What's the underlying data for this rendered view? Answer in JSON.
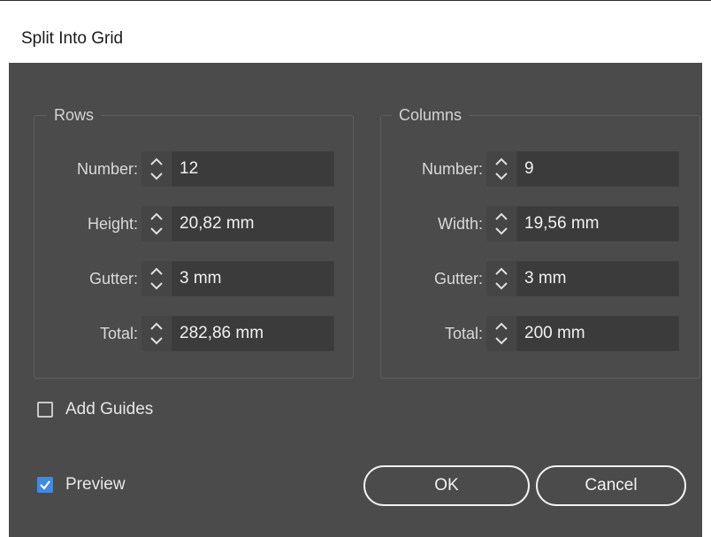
{
  "window": {
    "title": "Split Into Grid"
  },
  "rows_group": {
    "title": "Rows",
    "number": {
      "label": "Number:",
      "value": "12"
    },
    "height": {
      "label": "Height:",
      "value": "20,82 mm"
    },
    "gutter": {
      "label": "Gutter:",
      "value": "3 mm"
    },
    "total": {
      "label": "Total:",
      "value": "282,86 mm"
    }
  },
  "columns_group": {
    "title": "Columns",
    "number": {
      "label": "Number:",
      "value": "9"
    },
    "width": {
      "label": "Width:",
      "value": "19,56 mm"
    },
    "gutter": {
      "label": "Gutter:",
      "value": "3 mm"
    },
    "total": {
      "label": "Total:",
      "value": "200 mm"
    }
  },
  "options": {
    "add_guides": {
      "label": "Add Guides",
      "checked": false
    },
    "preview": {
      "label": "Preview",
      "checked": true
    }
  },
  "buttons": {
    "ok": "OK",
    "cancel": "Cancel"
  },
  "colors": {
    "dialog_bg": "#4b4b4b",
    "field_bg": "#3b3b3b",
    "accent": "#3d8be6"
  },
  "icons": {
    "stepper": "up-down-chevron-icon",
    "checkmark": "checkmark-icon"
  }
}
